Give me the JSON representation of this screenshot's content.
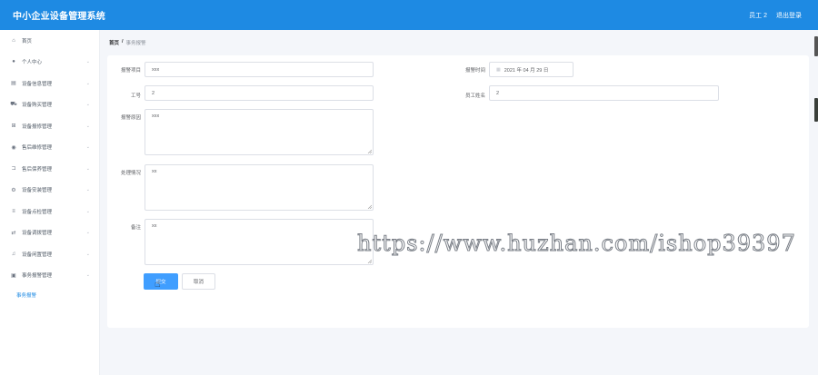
{
  "header": {
    "title": "中小企业设备管理系统",
    "user": "员工 2",
    "logout": "退出登录"
  },
  "sidebar": {
    "items": [
      {
        "label": "首页",
        "icon": "home-icon",
        "glyph": "⌂",
        "expandable": false
      },
      {
        "label": "个人中心",
        "icon": "user-icon",
        "glyph": "●",
        "expandable": true
      },
      {
        "label": "设备信息管理",
        "icon": "list-icon",
        "glyph": "▤",
        "expandable": true
      },
      {
        "label": "设备购买管理",
        "icon": "cart-icon",
        "glyph": "⛟",
        "expandable": true
      },
      {
        "label": "设备报修管理",
        "icon": "grid-icon",
        "glyph": "⊞",
        "expandable": true
      },
      {
        "label": "售后维修管理",
        "icon": "person-icon",
        "glyph": "◉",
        "expandable": true
      },
      {
        "label": "售后保养管理",
        "icon": "wrench-icon",
        "glyph": "⊐",
        "expandable": true
      },
      {
        "label": "设备安装管理",
        "icon": "tools-icon",
        "glyph": "⚙",
        "expandable": true
      },
      {
        "label": "设备点检管理",
        "icon": "lines-icon",
        "glyph": "≡",
        "expandable": true
      },
      {
        "label": "设备调拨管理",
        "icon": "transfer-icon",
        "glyph": "⇄",
        "expandable": true
      },
      {
        "label": "设备闲置管理",
        "icon": "bell-icon",
        "glyph": "♫",
        "expandable": true
      },
      {
        "label": "事务报警管理",
        "icon": "alarm-icon",
        "glyph": "▣",
        "expandable": true
      }
    ],
    "sub_item": "事务报警"
  },
  "breadcrumb": {
    "home": "首页",
    "separator": "/",
    "current": "事务报警"
  },
  "form": {
    "alarm_item_label": "报警项目",
    "alarm_item_value": "xxx",
    "alarm_time_label": "报警时间",
    "alarm_time_value": "2021 年 04 月 29 日",
    "employee_id_label": "工号",
    "employee_id_value": "2",
    "employee_name_label": "员工姓名",
    "employee_name_value": "2",
    "alarm_reason_label": "报警原因",
    "alarm_reason_value": "xxx",
    "handling_label": "处理情况",
    "handling_value": "xx",
    "remark_label": "备注",
    "remark_value": "xx",
    "submit_label": "提交",
    "cancel_label": "取消"
  },
  "watermark": "https://www.huzhan.com/ishop39397",
  "colors": {
    "header_bg": "#1e8ae3",
    "primary": "#409eff",
    "active_menu": "#1e8ae3"
  }
}
